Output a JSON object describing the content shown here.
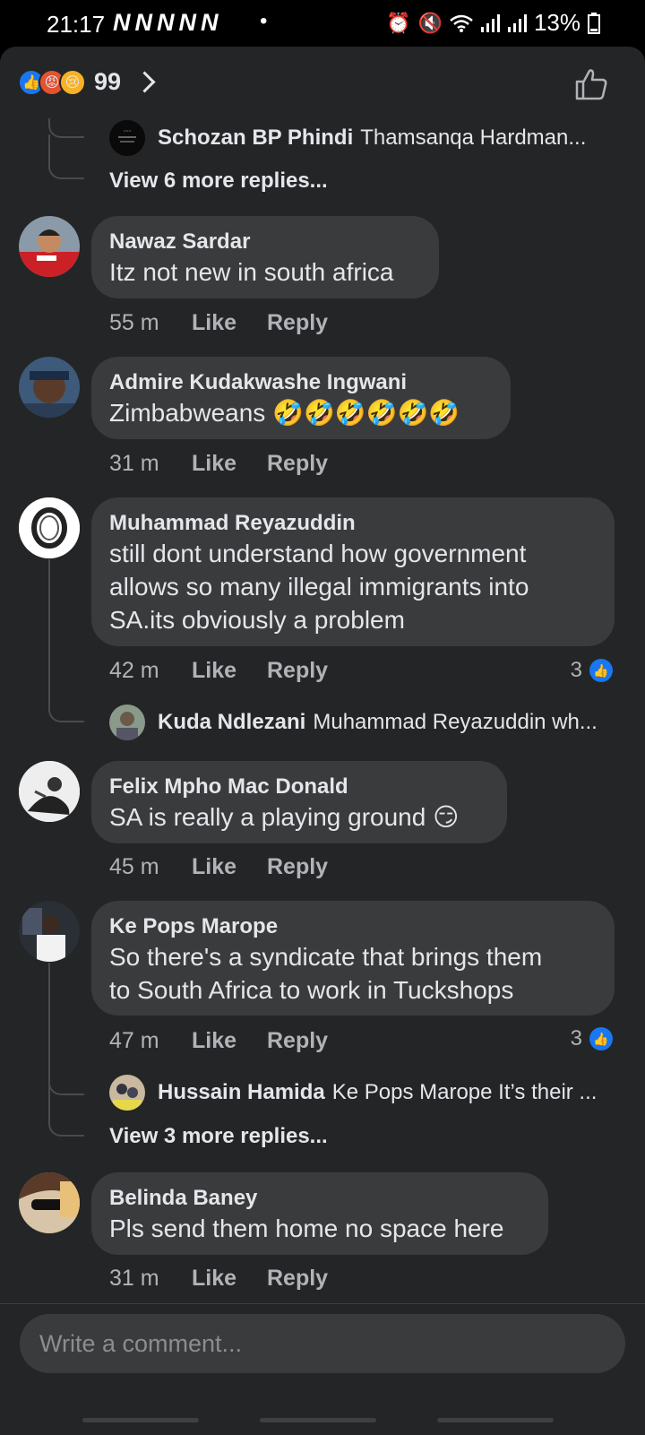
{
  "status_bar": {
    "time": "21:17",
    "n_icons": [
      "N",
      "N",
      "N",
      "N",
      "N"
    ],
    "dot": "•",
    "battery": "13%"
  },
  "reactions": {
    "count": "99"
  },
  "comments": [
    {
      "reply_preview": {
        "name": "Schozan BP Phindi",
        "text": "Thamsanqa Hardman..."
      },
      "more_replies": "View 6 more replies..."
    },
    {
      "name": "Nawaz Sardar",
      "text": [
        "Itz not new in south africa"
      ],
      "time": "55 m",
      "like": "Like",
      "reply": "Reply"
    },
    {
      "name": "Admire Kudakwashe Ingwani",
      "text": [
        "Zimbabweans 🤣🤣🤣🤣🤣🤣"
      ],
      "time": "31 m",
      "like": "Like",
      "reply": "Reply"
    },
    {
      "name": "Muhammad Reyazuddin",
      "text": [
        "still dont understand how government",
        "allows so many illegal immigrants into",
        "SA.its obviously a problem"
      ],
      "time": "42 m",
      "like": "Like",
      "reply": "Reply",
      "likes": "3",
      "reply_preview": {
        "name": "Kuda Ndlezani",
        "text": "Muhammad Reyazuddin wh..."
      }
    },
    {
      "name": "Felix Mpho Mac Donald",
      "text": [
        "SA is really a playing ground 😏"
      ],
      "time": "45 m",
      "like": "Like",
      "reply": "Reply"
    },
    {
      "name": "Ke Pops Marope",
      "text": [
        "So there's a syndicate that brings them",
        "to South Africa to work in Tuckshops"
      ],
      "time": "47 m",
      "like": "Like",
      "reply": "Reply",
      "likes": "3",
      "reply_preview": {
        "name": "Hussain Hamida",
        "text": "Ke Pops Marope It’s their ..."
      },
      "more_replies": "View 3 more replies..."
    },
    {
      "name": "Belinda Baney",
      "text": [
        "Pls send them home no space here"
      ],
      "time": "31 m",
      "like": "Like",
      "reply": "Reply"
    }
  ],
  "composer": {
    "placeholder": "Write a comment..."
  }
}
